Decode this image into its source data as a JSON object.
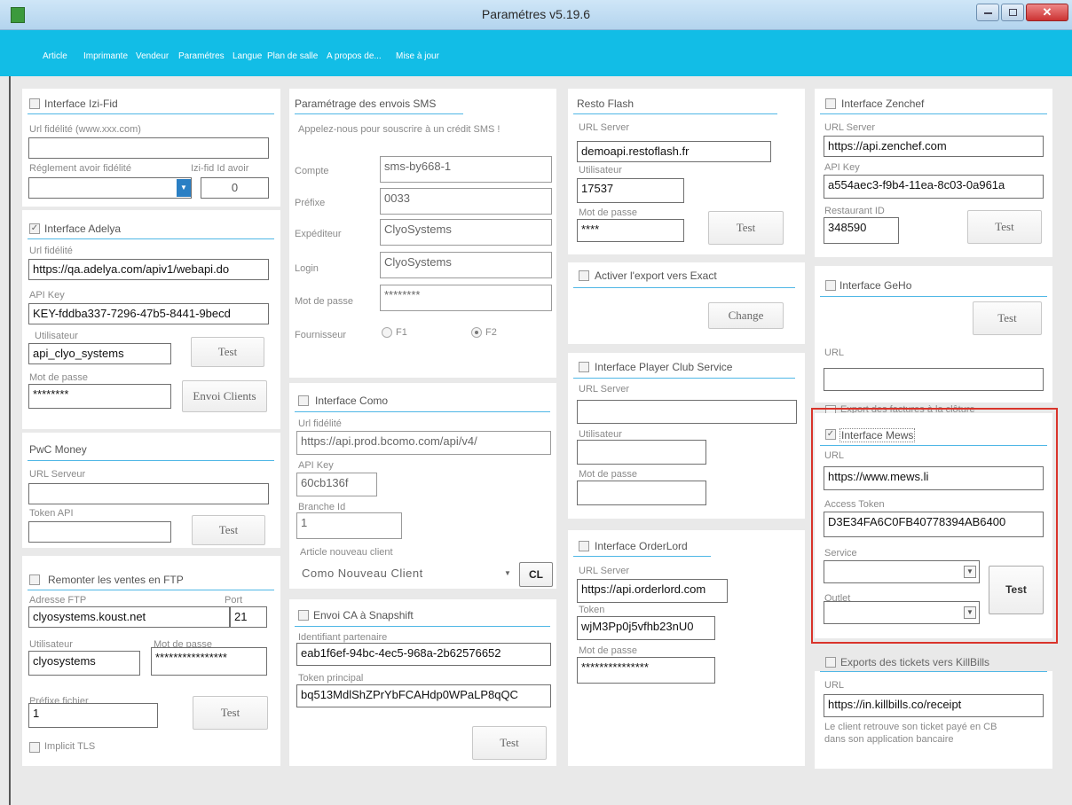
{
  "window": {
    "title": "Paramétres v5.19.6"
  },
  "menu": [
    "Article",
    "Imprimante",
    "Vendeur",
    "Paramétres",
    "Langue",
    "Plan de salle",
    "A propos de...",
    "Mise à jour"
  ],
  "izifid": {
    "title": "Interface Izi-Fid",
    "url_label": "Url fidélité (www.xxx.com)",
    "url_value": "",
    "reglement_label": "Réglement avoir fidélité",
    "reglement_value": "",
    "avoir_label": "Izi-fid Id avoir",
    "avoir_value": "0"
  },
  "adelya": {
    "title": "Interface Adelya",
    "url_label": "Url fidélité",
    "url_value": "https://qa.adelya.com/apiv1/webapi.do",
    "apikey_label": "API Key",
    "apikey_value": "KEY-fddba337-7296-47b5-8441-9becd",
    "user_label": "Utilisateur",
    "user_value": "api_clyo_systems",
    "pass_label": "Mot de passe",
    "pass_value": "********",
    "test": "Test",
    "envoi": "Envoi Clients"
  },
  "pwc": {
    "title": "PwC Money",
    "url_label": "URL Serveur",
    "url_value": "",
    "token_label": "Token API",
    "token_value": "",
    "test": "Test"
  },
  "ftp": {
    "title": "Remonter les ventes en FTP",
    "addr_label": "Adresse FTP",
    "addr_value": "clyosystems.koust.net",
    "port_label": "Port",
    "port_value": "21",
    "user_label": "Utilisateur",
    "user_value": "clyosystems",
    "pass_label": "Mot de passe",
    "pass_value": "****************",
    "prefix_label": "Préfixe fichier",
    "prefix_value": "1",
    "test": "Test",
    "tls": "Implicit TLS"
  },
  "sms": {
    "title": "Paramétrage des envois SMS",
    "subtitle": "Appelez-nous pour souscrire à un crédit SMS !",
    "compte_label": "Compte",
    "compte_value": "sms-by668-1",
    "prefixe_label": "Préfixe",
    "prefixe_value": "0033",
    "exp_label": "Expéditeur",
    "exp_value": "ClyoSystems",
    "login_label": "Login",
    "login_value": "ClyoSystems",
    "pass_label": "Mot de passe",
    "pass_value": "********",
    "four_label": "Fournisseur",
    "f1": "F1",
    "f2": "F2"
  },
  "como": {
    "title": "Interface Como",
    "url_label": "Url fidélité",
    "url_value": "https://api.prod.bcomo.com/api/v4/",
    "apikey_label": "API Key",
    "apikey_value": "60cb136f",
    "branche_label": "Branche Id",
    "branche_value": "1",
    "article_label": "Article nouveau client",
    "article_value": "Como Nouveau Client",
    "cl": "CL"
  },
  "snapshift": {
    "title": "Envoi CA à Snapshift",
    "id_label": "Identifiant partenaire",
    "id_value": "eab1f6ef-94bc-4ec5-968a-2b62576652",
    "token_label": "Token principal",
    "token_value": "bq513MdlShZPrYbFCAHdp0WPaLP8qQC",
    "test": "Test"
  },
  "resto": {
    "title": "Resto Flash",
    "url_label": "URL Server",
    "url_value": "demoapi.restoflash.fr",
    "user_label": "Utilisateur",
    "user_value": "17537",
    "pass_label": "Mot de passe",
    "pass_value": "****",
    "test": "Test"
  },
  "exact": {
    "title": "Activer l'export vers Exact",
    "change": "Change"
  },
  "player": {
    "title": "Interface Player Club Service",
    "url_label": "URL Server",
    "user_label": "Utilisateur",
    "pass_label": "Mot de passe"
  },
  "orderlord": {
    "title": "Interface OrderLord",
    "url_label": "URL Server",
    "url_value": "https://api.orderlord.com",
    "token_label": "Token",
    "token_value": "wjM3Pp0j5vfhb23nU0",
    "pass_label": "Mot de passe",
    "pass_value": "***************"
  },
  "zenchef": {
    "title": "Interface Zenchef",
    "url_label": "URL Server",
    "url_value": "https://api.zenchef.com",
    "apikey_label": "API Key",
    "apikey_value": "a554aec3-f9b4-11ea-8c03-0a961a",
    "rest_label": "Restaurant ID",
    "rest_value": "348590",
    "test": "Test"
  },
  "geho": {
    "title": "Interface GeHo",
    "url_label": "URL",
    "test": "Test",
    "export": "Export des factures à la clôture"
  },
  "mews": {
    "title": "Interface Mews",
    "url_label": "URL",
    "url_value": "https://www.mews.li",
    "token_label": "Access Token",
    "token_value": "D3E34FA6C0FB40778394AB6400",
    "service_label": "Service",
    "outlet_label": "Outlet",
    "test": "Test"
  },
  "killbills": {
    "title": "Exports des tickets vers KillBills",
    "url_label": "URL",
    "url_value": "https://in.killbills.co/receipt",
    "note1": "Le client retrouve son ticket payé en CB",
    "note2": "dans son application bancaire"
  }
}
